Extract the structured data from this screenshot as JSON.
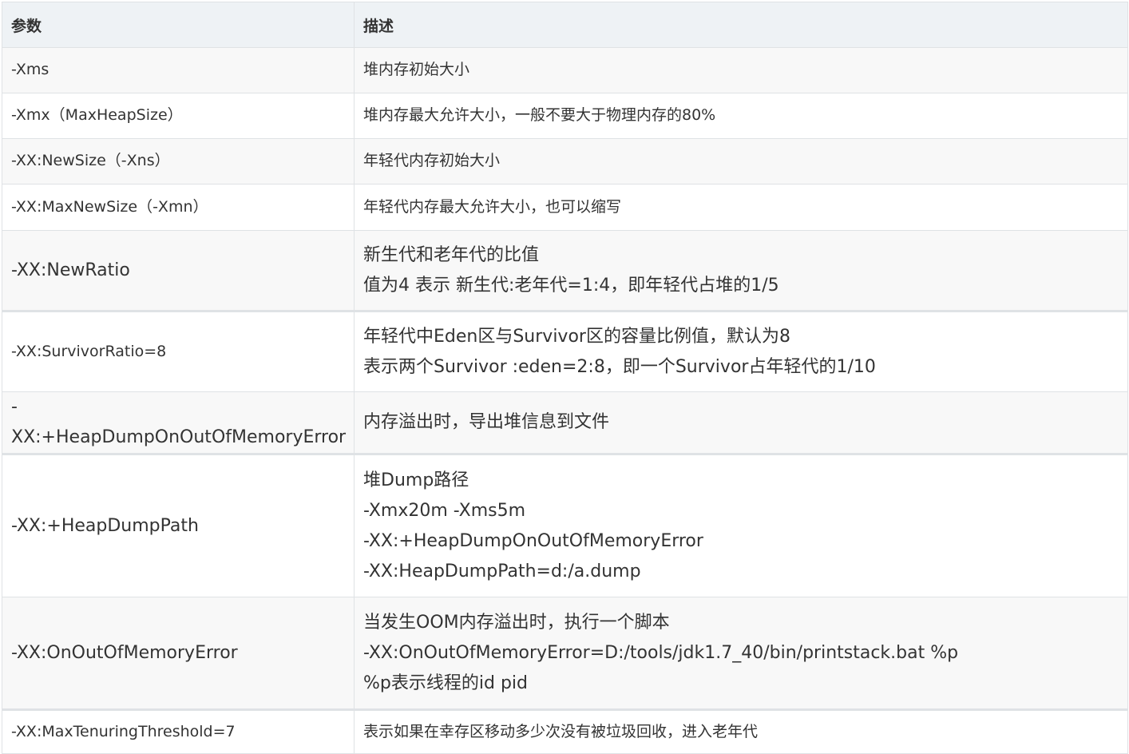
{
  "headers": {
    "param": "参数",
    "desc": "描述"
  },
  "rows": [
    {
      "param": "-Xms",
      "desc": [
        "堆内存初始大小"
      ]
    },
    {
      "param": "-Xmx（MaxHeapSize）",
      "desc": [
        "堆内存最大允许大小，一般不要大于物理内存的80%"
      ]
    },
    {
      "param": "-XX:NewSize（-Xns）",
      "desc": [
        "年轻代内存初始大小"
      ]
    },
    {
      "param": "-XX:MaxNewSize（-Xmn）",
      "desc": [
        "年轻代内存最大允许大小，也可以缩写"
      ]
    },
    {
      "param": "-XX:NewRatio",
      "desc": [
        "新生代和老年代的比值",
        "值为4 表示 新生代:老年代=1:4，即年轻代占堆的1/5"
      ]
    },
    {
      "param": "-XX:SurvivorRatio=8",
      "desc": [
        "年轻代中Eden区与Survivor区的容量比例值，默认为8",
        "表示两个Survivor :eden=2:8，即一个Survivor占年轻代的1/10"
      ]
    },
    {
      "param": "-XX:+HeapDumpOnOutOfMemoryError",
      "desc": [
        "内存溢出时，导出堆信息到文件"
      ]
    },
    {
      "param": "-XX:+HeapDumpPath",
      "desc": [
        "堆Dump路径",
        "-Xmx20m -Xms5m",
        "-XX:+HeapDumpOnOutOfMemoryError",
        "-XX:HeapDumpPath=d:/a.dump"
      ]
    },
    {
      "param": "-XX:OnOutOfMemoryError",
      "desc": [
        "当发生OOM内存溢出时，执行一个脚本",
        "-XX:OnOutOfMemoryError=D:/tools/jdk1.7_40/bin/printstack.bat %p",
        "%p表示线程的id pid"
      ]
    },
    {
      "param": "-XX:MaxTenuringThreshold=7",
      "desc": [
        "表示如果在幸存区移动多少次没有被垃圾回收，进入老年代"
      ]
    }
  ]
}
